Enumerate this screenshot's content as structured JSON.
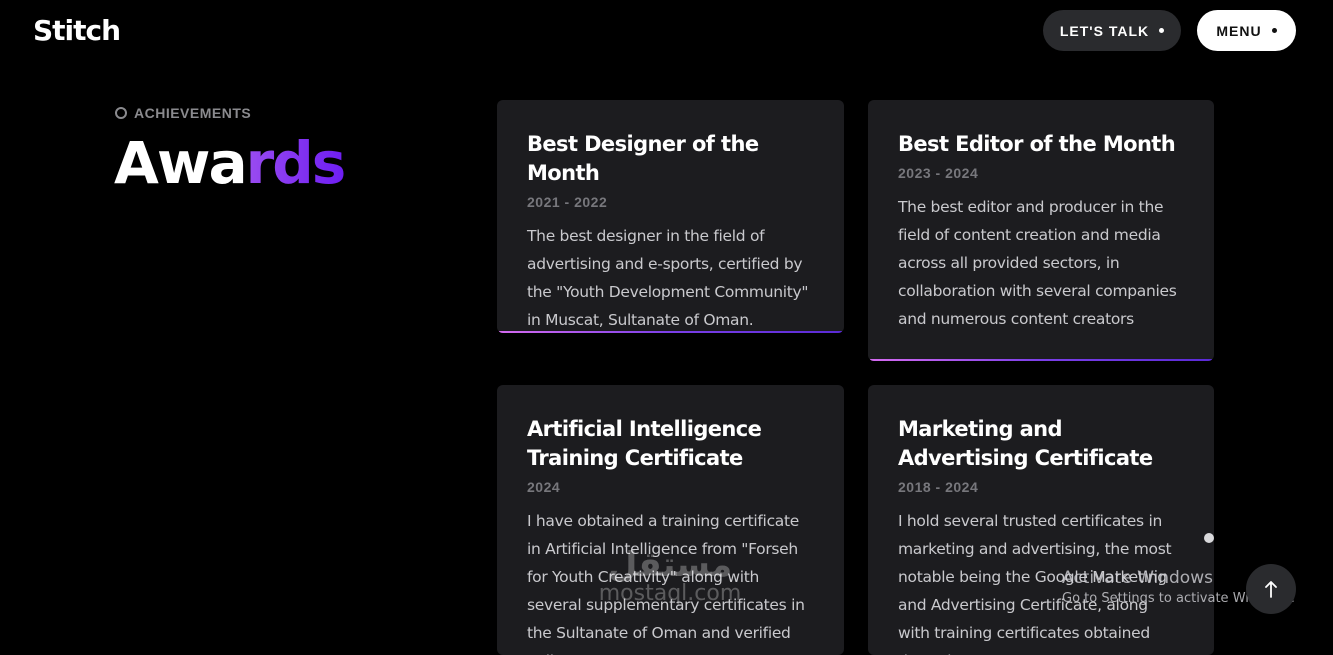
{
  "header": {
    "logo": "Stitch",
    "talk_button": "LET'S TALK",
    "menu_button": "MENU"
  },
  "section": {
    "eyebrow": "ACHIEVEMENTS",
    "title_part1": "Awa",
    "title_part2": "rds"
  },
  "awards": [
    {
      "title": "Best Designer of the Month",
      "years": "2021 - 2022",
      "description": "The best designer in the field of advertising and e-sports, certified by the \"Youth Development Community\" in Muscat, Sultanate of Oman."
    },
    {
      "title": "Best Editor of the Month",
      "years": "2023 - 2024",
      "description": "The best editor and producer in the field of content creation and media across all provided sectors, in collaboration with several companies and numerous content creators"
    },
    {
      "title": "Artificial Intelligence Training Certificate",
      "years": "2024",
      "description": "I have obtained a training certificate in Artificial Intelligence from \"Forseh for Youth Creativity\" along with several supplementary certificates in the Sultanate of Oman and verified online"
    },
    {
      "title": "Marketing and Advertising Certificate",
      "years": "2018 - 2024",
      "description": "I hold several trusted certificates in marketing and advertising, the most notable being the Google Marketing and Advertising Certificate, along with training certificates obtained through"
    }
  ],
  "watermark": {
    "arabic": "مستقل",
    "latin": "mostaql.com"
  },
  "os_overlay": {
    "line1": "Activate Windows",
    "line2": "Go to Settings to activate Windows."
  },
  "icons": {
    "scroll_top": "arrow-up-icon",
    "talk_dot": "dot-icon",
    "menu_dot": "dot-icon",
    "eyebrow": "circle-outline-icon"
  },
  "colors": {
    "background": "#000000",
    "card": "#1c1c1f",
    "accent_start": "#d56bf0",
    "accent_end": "#5a2ad6",
    "title_gradient_start": "#9a4cf0",
    "title_gradient_end": "#6e1ef2"
  }
}
